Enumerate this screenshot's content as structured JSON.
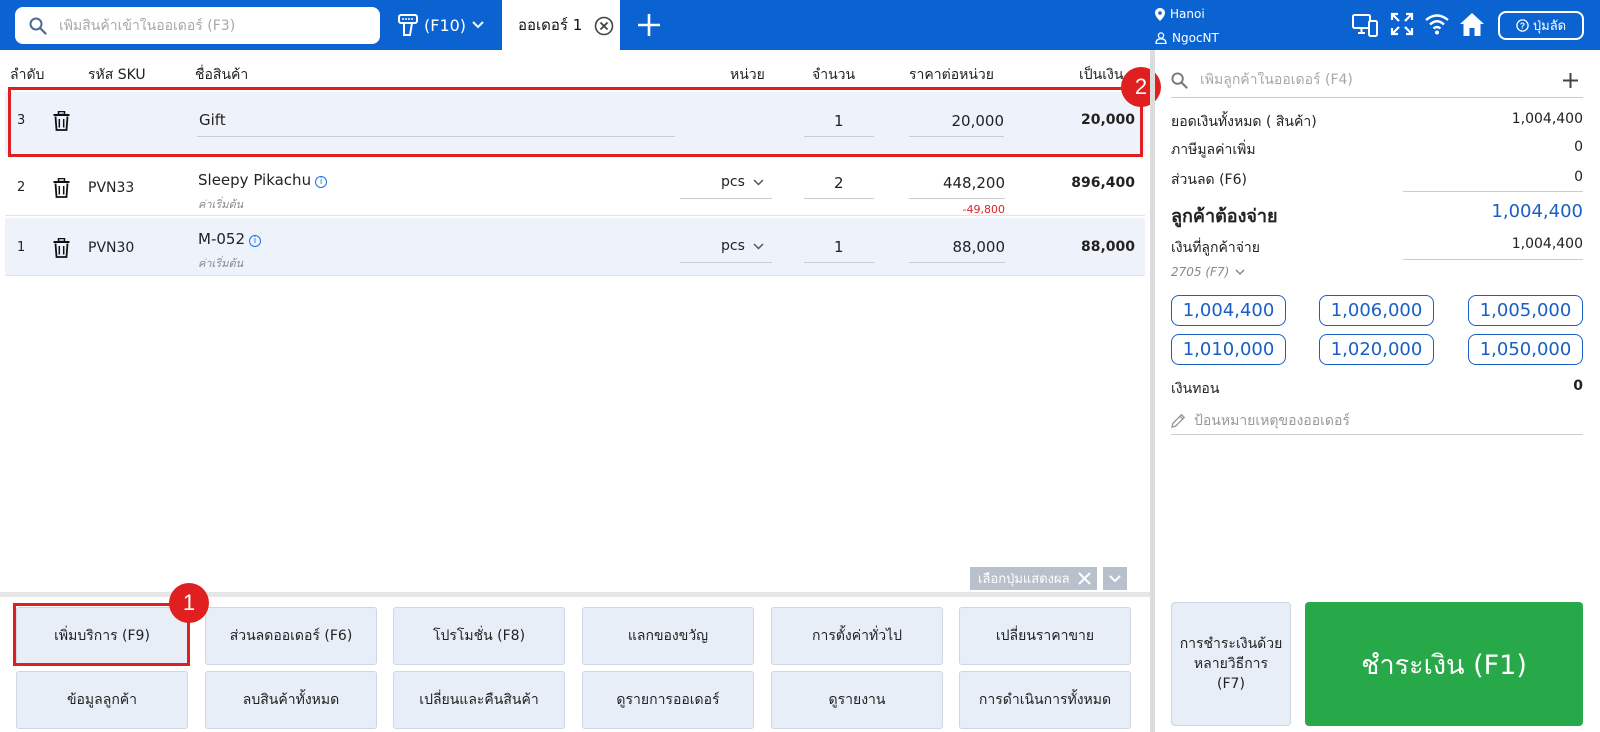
{
  "topbar": {
    "search_placeholder": "เพิ่มสินค้าเข้าในออเดอร์ (F3)",
    "barcode_label": "(F10)",
    "active_tab": "ออเดอร์ 1",
    "location": "Hanoi",
    "user": "NgocNT",
    "shortcut_label": "ปุ่มลัด"
  },
  "table": {
    "headers": {
      "index": "ลำดับ",
      "sku": "รหัส SKU",
      "name": "ชื่อสินค้า",
      "unit": "หน่วย",
      "qty": "จำนวน",
      "unit_price": "ราคาต่อหน่วย",
      "total": "เป็นเงิน"
    },
    "rows": [
      {
        "index": "3",
        "sku": "",
        "name": "Gift",
        "note": "",
        "unit": "",
        "qty": "1",
        "price": "20,000",
        "discount": "",
        "total": "20,000"
      },
      {
        "index": "2",
        "sku": "PVN33",
        "name": "Sleepy Pikachu",
        "note": "ค่าเริ่มต้น",
        "unit": "pcs",
        "qty": "2",
        "price": "448,200",
        "discount": "-49,800",
        "total": "896,400"
      },
      {
        "index": "1",
        "sku": "PVN30",
        "name": "M-052",
        "note": "ค่าเริ่มต้น",
        "unit": "pcs",
        "qty": "1",
        "price": "88,000",
        "discount": "",
        "total": "88,000"
      }
    ]
  },
  "annotations": {
    "badge1": "1",
    "badge2": "2"
  },
  "results_chip": "เลือกปุ่มแสดงผล",
  "actions": [
    "เพิ่มบริการ (F9)",
    "ส่วนลดออเดอร์ (F6)",
    "โปรโมชั่น (F8)",
    "แลกของขวัญ",
    "การตั้งค่าทั่วไป",
    "เปลี่ยนราคาขาย",
    "ข้อมูลลูกค้า",
    "ลบสินค้าทั้งหมด",
    "เปลี่ยนและคืนสินค้า",
    "ดูรายการออเดอร์",
    "ดูรายงาน",
    "การดำเนินการทั้งหมด"
  ],
  "summary": {
    "customer_placeholder": "เพิ่มลูกค้าในออเดอร์ (F4)",
    "total_label": "ยอดเงินทั้งหมด ( สินค้า)",
    "total_value": "1,004,400",
    "vat_label": "ภาษีมูลค่าเพิ่ม",
    "vat_value": "0",
    "discount_label": "ส่วนลด (F6)",
    "discount_value": "0",
    "to_pay_label": "ลูกค้าต้องจ่าย",
    "to_pay_value": "1,004,400",
    "paid_label": "เงินที่ลูกค้าจ่าย",
    "paid_value": "1,004,400",
    "method": "2705 (F7)",
    "quick_amounts": [
      "1,004,400",
      "1,006,000",
      "1,005,000",
      "1,010,000",
      "1,020,000",
      "1,050,000"
    ],
    "change_label": "เงินทอน",
    "change_value": "0",
    "note_placeholder": "ป้อนหมายเหตุของออเดอร์",
    "multi_pay_label": "การชำระเงินด้วยหลายวิธีการ (F7)",
    "pay_label": "ชำระเงิน (F1)"
  },
  "colors": {
    "primary": "#0a63d1",
    "pay_green": "#27a849",
    "highlight_red": "#e02020"
  }
}
